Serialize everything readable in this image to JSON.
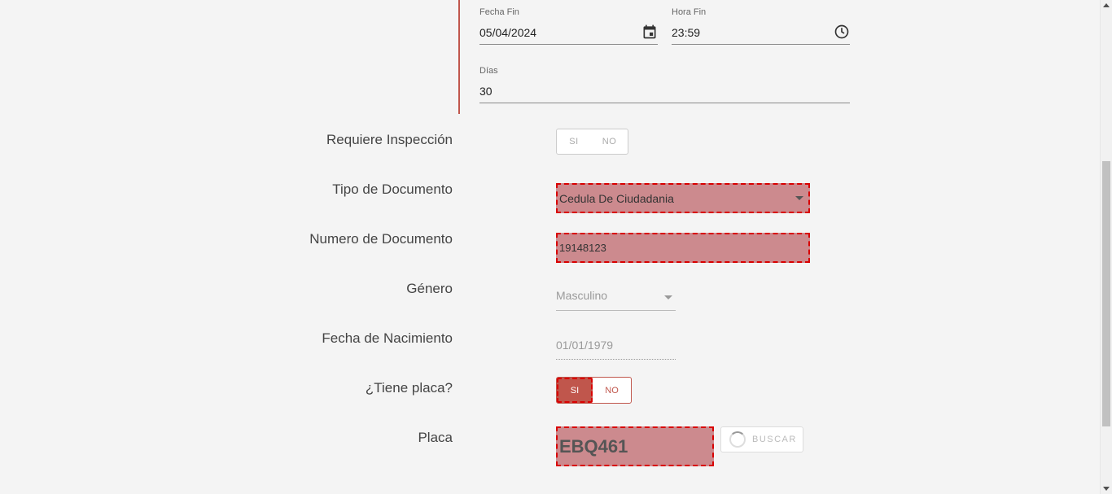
{
  "period": {
    "fecha_fin": {
      "label": "Fecha Fin",
      "value": "05/04/2024",
      "icon": "calendar-icon"
    },
    "hora_fin": {
      "label": "Hora Fin",
      "value": "23:59",
      "icon": "clock-icon"
    },
    "dias": {
      "label": "Días",
      "value": "30"
    }
  },
  "form": {
    "requiere_inspeccion": {
      "label": "Requiere Inspección",
      "options": [
        "SI",
        "NO"
      ]
    },
    "tipo_documento": {
      "label": "Tipo de Documento",
      "value": "Cedula De Ciudadania"
    },
    "numero_documento": {
      "label": "Numero de Documento",
      "value": "19148123"
    },
    "genero": {
      "label": "Género",
      "value": "Masculino"
    },
    "fecha_nacimiento": {
      "label": "Fecha de Nacimiento",
      "value": "01/01/1979"
    },
    "tiene_placa": {
      "label": "¿Tiene placa?",
      "options": [
        "SI",
        "NO"
      ],
      "selected": "SI"
    },
    "placa": {
      "label": "Placa",
      "value": "EBQ461",
      "button_label": "BUSCAR"
    }
  },
  "colors": {
    "accent": "#c0564c",
    "highlight_bg": "#cc8a8e",
    "highlight_border": "#d90000"
  }
}
